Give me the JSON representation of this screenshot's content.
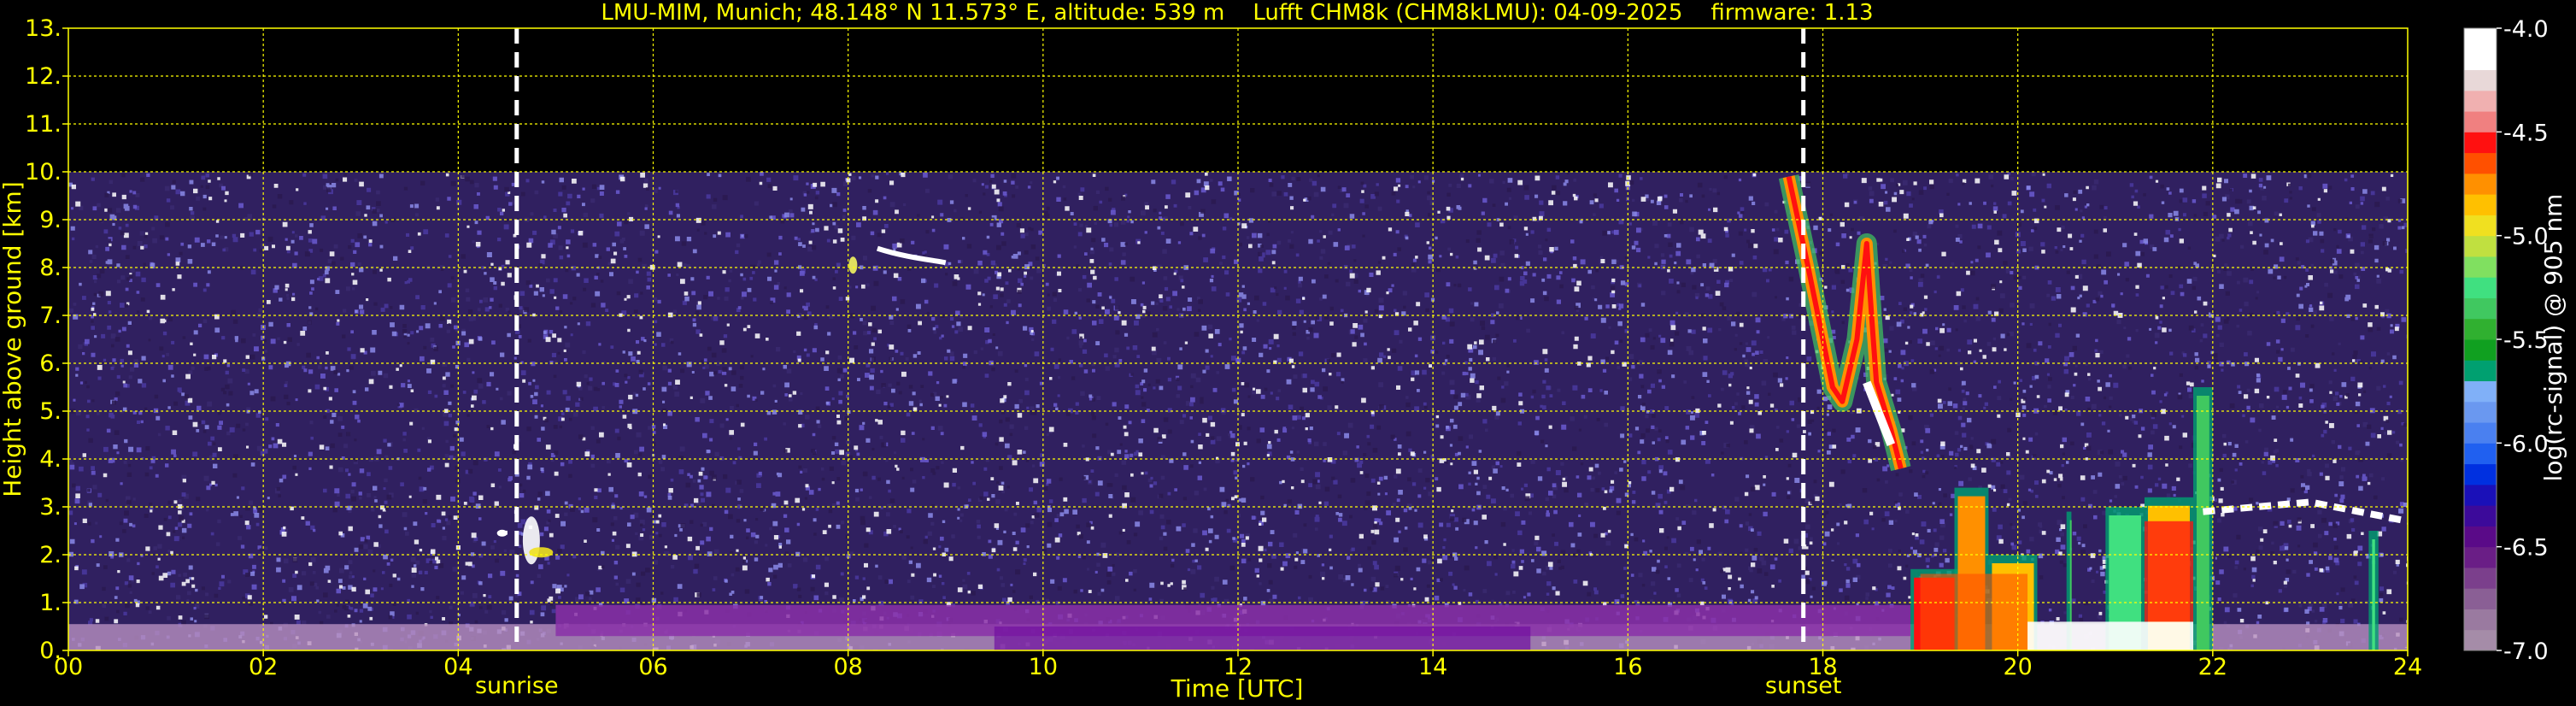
{
  "chart_data": {
    "type": "heatmap",
    "title": "LMU-MIM, Munich; 48.148° N 11.573° E, altitude: 539 m    Lufft CHM8k (CHM8kLMU): 04-09-2025    firmware: 1.13",
    "xlabel": "Time [UTC]",
    "ylabel": "Height above ground [km]",
    "xlim": [
      0,
      24
    ],
    "ylim": [
      0,
      13
    ],
    "x_ticks": [
      "00",
      "02",
      "04",
      "06",
      "08",
      "10",
      "12",
      "14",
      "16",
      "18",
      "20",
      "22",
      "24"
    ],
    "y_ticks": [
      "0.",
      "1.",
      "2.",
      "3.",
      "4.",
      "5.",
      "6.",
      "7.",
      "8.",
      "9.",
      "10.",
      "11.",
      "12.",
      "13."
    ],
    "grid": true,
    "data_top_km": 10,
    "annotations": [
      {
        "label": "sunrise",
        "x": 4.6
      },
      {
        "label": "sunset",
        "x": 17.8
      }
    ],
    "colorbar": {
      "label": "log(rc-signal) @ 905 nm",
      "range": [
        -7.0,
        -4.0
      ],
      "ticks": [
        "-4.0",
        "-4.5",
        "-5.0",
        "-5.5",
        "-6.0",
        "-6.5",
        "-7.0"
      ],
      "tick_values": [
        -4.0,
        -4.5,
        -5.0,
        -5.5,
        -6.0,
        -6.5,
        -7.0
      ],
      "colors": [
        "#a58ca8",
        "#9a7aa0",
        "#8a5f95",
        "#7b3f8c",
        "#6a1e86",
        "#5a0a88",
        "#3c0a9a",
        "#1a10b8",
        "#0030e0",
        "#2060f0",
        "#4a80f0",
        "#6a98f0",
        "#80b0f8",
        "#00a070",
        "#10a020",
        "#30b030",
        "#40c860",
        "#40e080",
        "#80e060",
        "#c0e040",
        "#f0e020",
        "#ffc000",
        "#ff9000",
        "#ff5000",
        "#ff1010",
        "#f08080",
        "#f0b0b0",
        "#e8d8d8",
        "#ffffff",
        "#ffffff"
      ]
    },
    "background_noise_colors": [
      "#3a2a70",
      "#4a3aa0",
      "#6a5ad0",
      "#8a8ae8",
      "#ffffff",
      "#2a1a50"
    ],
    "features": [
      {
        "name": "boundary layer",
        "x": [
          0,
          24
        ],
        "y": [
          0,
          1.0
        ],
        "value": -6.6
      },
      {
        "name": "cloud layer early morning",
        "x": [
          4.6,
          5.0
        ],
        "y": [
          1.9,
          2.9
        ],
        "value": -4.5
      },
      {
        "name": "cirrus 08-09 UTC",
        "x": [
          8.0,
          9.0
        ],
        "y": [
          7.9,
          8.6
        ],
        "value": -4.6
      },
      {
        "name": "cloud evening descending",
        "x": [
          17.7,
          18.7
        ],
        "y": [
          3.7,
          9.9
        ],
        "value": -5.0
      },
      {
        "name": "low clouds 19-23 UTC",
        "x": [
          18.9,
          24.0
        ],
        "y": [
          0,
          3.6
        ],
        "value": -5.0
      }
    ]
  }
}
